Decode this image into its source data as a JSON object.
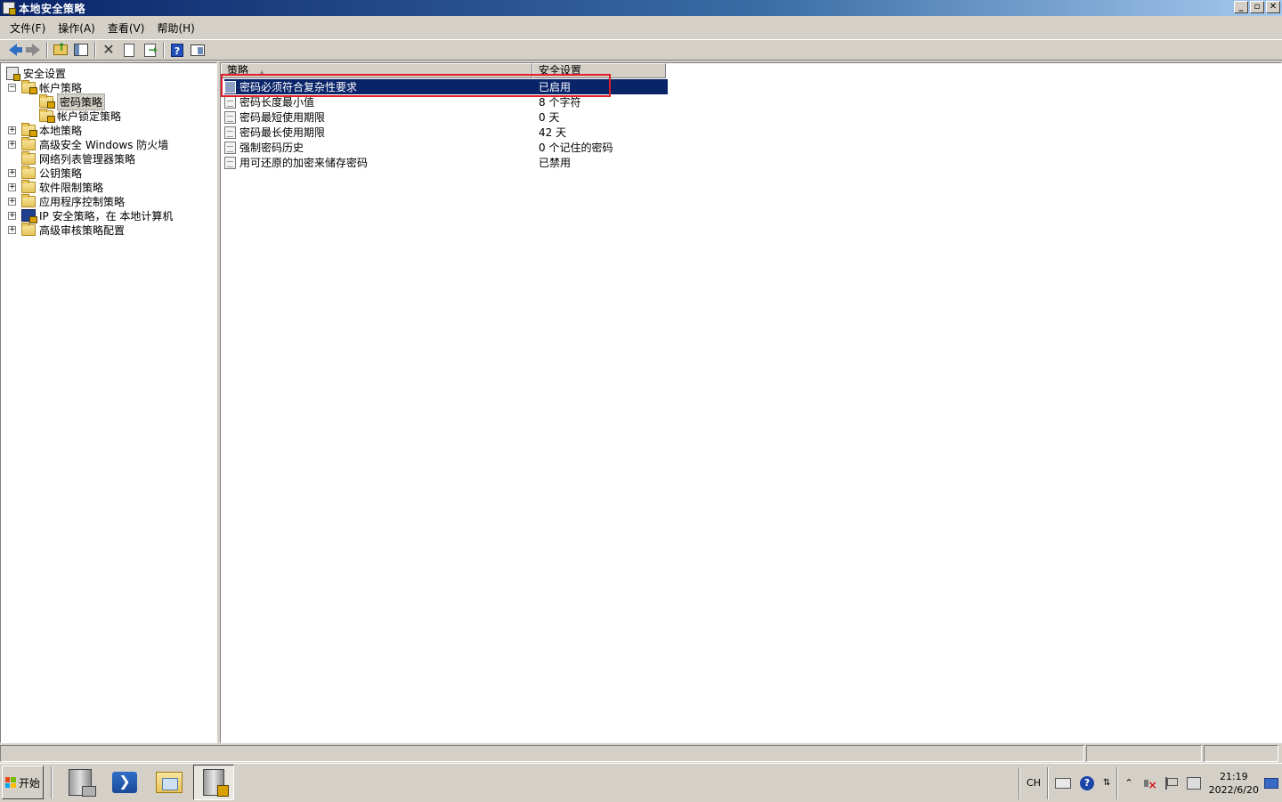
{
  "window": {
    "title": "本地安全策略",
    "controls": {
      "minimize": "_",
      "restore": "▫",
      "close": "✕"
    }
  },
  "menu": [
    "文件(F)",
    "操作(A)",
    "查看(V)",
    "帮助(H)"
  ],
  "toolbar": {
    "buttons": [
      "back-icon",
      "forward-icon",
      "up-folder-icon",
      "show-hide-tree-icon",
      "delete-icon",
      "properties-icon",
      "export-list-icon",
      "help-icon",
      "view-icon"
    ]
  },
  "tree": {
    "root": "安全设置",
    "account_policies": "帐户策略",
    "password_policy": "密码策略",
    "lockout_policy": "帐户锁定策略",
    "local_policies": "本地策略",
    "firewall": "高级安全 Windows 防火墙",
    "network_list": "网络列表管理器策略",
    "public_key": "公钥策略",
    "software_restriction": "软件限制策略",
    "applocker": "应用程序控制策略",
    "ipsec": "IP 安全策略，在 本地计算机",
    "audit": "高级审核策略配置",
    "expand_mark": "+",
    "collapse_mark": "−"
  },
  "list": {
    "columns": [
      "策略",
      "安全设置"
    ],
    "sort_mark": "▲",
    "rows": [
      {
        "policy": "密码必须符合复杂性要求",
        "setting": "已启用",
        "selected": true
      },
      {
        "policy": "密码长度最小值",
        "setting": "8 个字符",
        "selected": false
      },
      {
        "policy": "密码最短使用期限",
        "setting": "0 天",
        "selected": false
      },
      {
        "policy": "密码最长使用期限",
        "setting": "42 天",
        "selected": false
      },
      {
        "policy": "强制密码历史",
        "setting": "0 个记住的密码",
        "selected": false
      },
      {
        "policy": "用可还原的加密来储存密码",
        "setting": "已禁用",
        "selected": false
      }
    ]
  },
  "taskbar": {
    "start_label": "开始",
    "apps": [
      "server-manager-icon",
      "powershell-icon",
      "explorer-icon",
      "local-security-policy-icon"
    ],
    "powershell_glyph": "❯",
    "tray": {
      "lang": "CH",
      "help_glyph": "?",
      "updown_glyph": "⇅",
      "expand_glyph": "⌃",
      "time": "21:19",
      "date": "2022/6/20"
    }
  },
  "colors": {
    "selection": "#0a246a",
    "highlight_box": "#e0202a",
    "titlebar": "#0a246a",
    "face": "#d4d0c8"
  }
}
